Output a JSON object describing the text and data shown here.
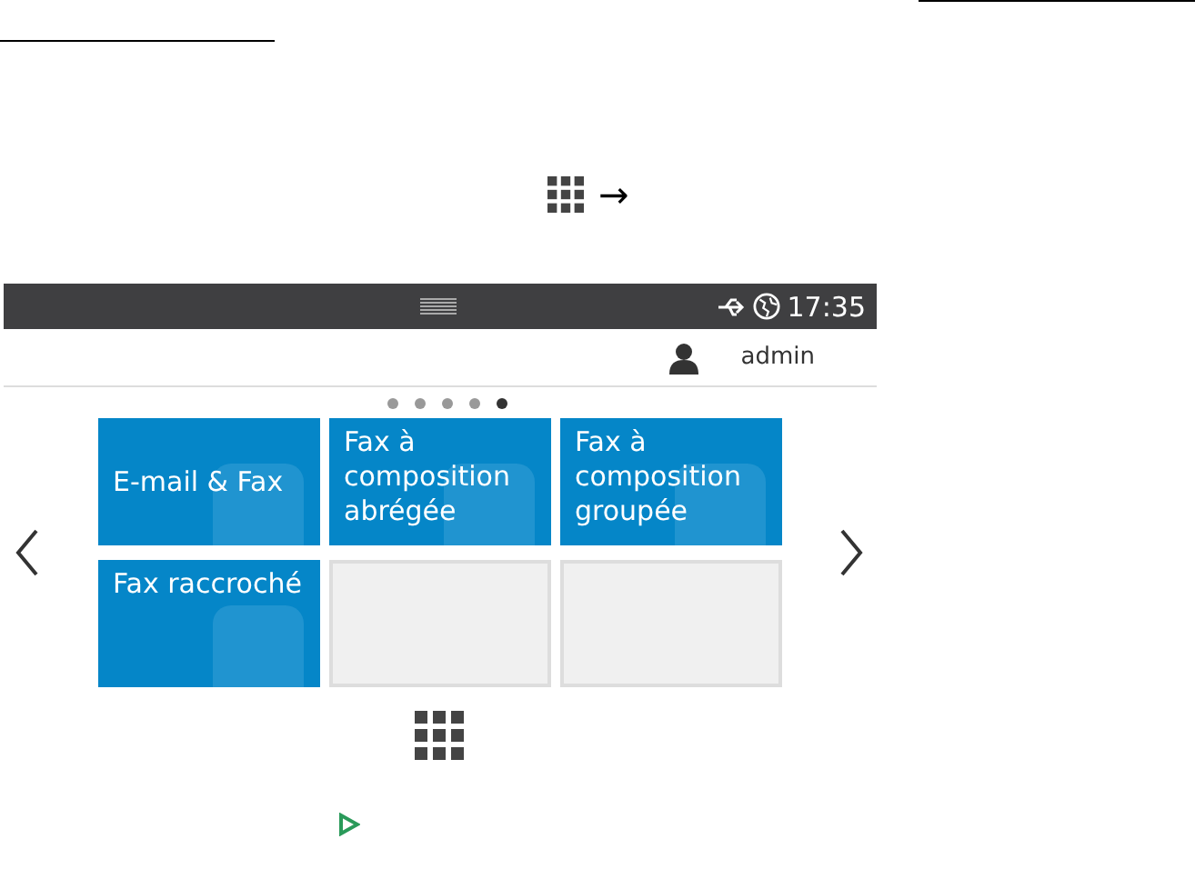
{
  "instruction": {
    "arrow": "→"
  },
  "status_bar": {
    "time": "17:35"
  },
  "header": {
    "user": "admin"
  },
  "pager": [
    {
      "selected": false
    },
    {
      "selected": false
    },
    {
      "selected": false
    },
    {
      "selected": false
    },
    {
      "selected": true
    }
  ],
  "tiles": [
    {
      "kind": "app",
      "label": "E-mail & Fax"
    },
    {
      "kind": "app",
      "label": "Fax à composition abrégée"
    },
    {
      "kind": "app",
      "label": "Fax à composition groupée"
    },
    {
      "kind": "app",
      "label": "Fax raccroché"
    },
    {
      "kind": "empty"
    },
    {
      "kind": "empty"
    }
  ]
}
